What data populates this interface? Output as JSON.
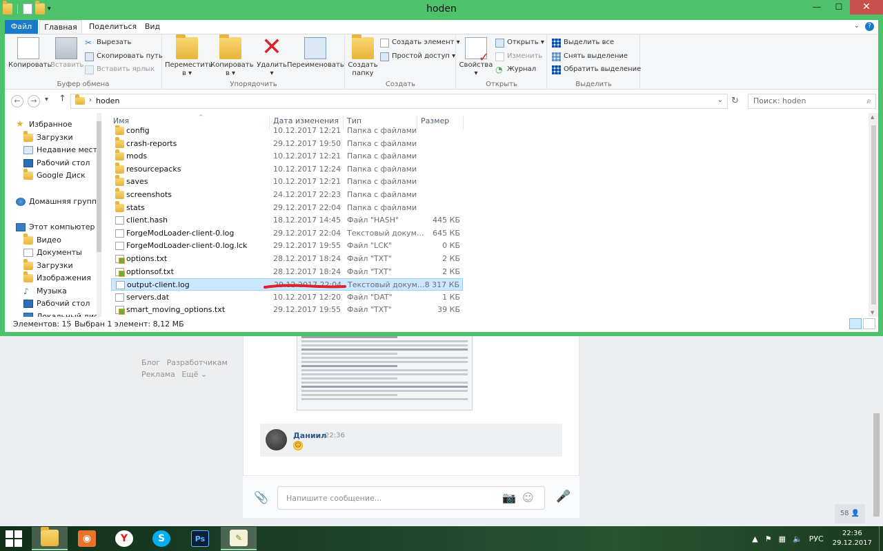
{
  "window": {
    "title": "hoden",
    "controls": {
      "minimize": "—",
      "maximize": "☐",
      "close": "✕"
    }
  },
  "ribbon_tabs": [
    "Файл",
    "Главная",
    "Поделиться",
    "Вид"
  ],
  "ribbon": {
    "clipboard": {
      "label": "Буфер обмена",
      "copy": "Копировать",
      "paste": "Вставить",
      "cut": "Вырезать",
      "copy_path": "Скопировать путь",
      "paste_shortcut": "Вставить ярлык"
    },
    "organize": {
      "label": "Упорядочить",
      "move_to": [
        "Переместить",
        "в ▾"
      ],
      "copy_to": [
        "Копировать",
        "в ▾"
      ],
      "delete": [
        "Удалить",
        "▾"
      ],
      "rename": "Переименовать"
    },
    "new": {
      "label": "Создать",
      "new_folder": [
        "Создать",
        "папку"
      ],
      "new_item": "Создать элемент ▾",
      "easy_access": "Простой доступ ▾"
    },
    "open": {
      "label": "Открыть",
      "properties": [
        "Свойства",
        "▾"
      ],
      "open": "Открыть ▾",
      "edit": "Изменить",
      "history": "Журнал"
    },
    "select": {
      "label": "Выделить",
      "select_all": "Выделить все",
      "select_none": "Снять выделение",
      "invert": "Обратить выделение"
    }
  },
  "address": {
    "path": "hoden",
    "search_placeholder": "Поиск: hoden"
  },
  "nav_pane": {
    "favorites": "Избранное",
    "favorites_items": [
      "Загрузки",
      "Недавние места",
      "Рабочий стол",
      "Google Диск"
    ],
    "homegroup": "Домашняя группа",
    "this_pc": "Этот компьютер",
    "pc_items": [
      "Видео",
      "Документы",
      "Загрузки",
      "Изображения",
      "Музыка",
      "Рабочий стол",
      "Локальный диск"
    ]
  },
  "columns": {
    "name": "Имя",
    "date": "Дата изменения",
    "type": "Тип",
    "size": "Размер"
  },
  "files": [
    {
      "name": "config",
      "date": "10.12.2017 12:21",
      "type": "Папка с файлами",
      "size": "",
      "kind": "folder"
    },
    {
      "name": "crash-reports",
      "date": "29.12.2017 19:50",
      "type": "Папка с файлами",
      "size": "",
      "kind": "folder"
    },
    {
      "name": "mods",
      "date": "10.12.2017 12:21",
      "type": "Папка с файлами",
      "size": "",
      "kind": "folder"
    },
    {
      "name": "resourcepacks",
      "date": "10.12.2017 12:24",
      "type": "Папка с файлами",
      "size": "",
      "kind": "folder"
    },
    {
      "name": "saves",
      "date": "10.12.2017 12:21",
      "type": "Папка с файлами",
      "size": "",
      "kind": "folder"
    },
    {
      "name": "screenshots",
      "date": "24.12.2017 22:23",
      "type": "Папка с файлами",
      "size": "",
      "kind": "folder"
    },
    {
      "name": "stats",
      "date": "29.12.2017 22:04",
      "type": "Папка с файлами",
      "size": "",
      "kind": "folder"
    },
    {
      "name": "client.hash",
      "date": "18.12.2017 14:45",
      "type": "Файл \"HASH\"",
      "size": "445 КБ",
      "kind": "file"
    },
    {
      "name": "ForgeModLoader-client-0.log",
      "date": "29.12.2017 22:04",
      "type": "Текстовый докум...",
      "size": "645 КБ",
      "kind": "file"
    },
    {
      "name": "ForgeModLoader-client-0.log.lck",
      "date": "29.12.2017 19:55",
      "type": "Файл \"LCK\"",
      "size": "0 КБ",
      "kind": "file"
    },
    {
      "name": "options.txt",
      "date": "28.12.2017 18:24",
      "type": "Файл \"TXT\"",
      "size": "2 КБ",
      "kind": "txt"
    },
    {
      "name": "optionsof.txt",
      "date": "28.12.2017 18:24",
      "type": "Файл \"TXT\"",
      "size": "2 КБ",
      "kind": "txt"
    },
    {
      "name": "output-client.log",
      "date": "29.12.2017 22:04",
      "type": "Текстовый докум...",
      "size": "8 317 КБ",
      "kind": "file",
      "selected": true
    },
    {
      "name": "servers.dat",
      "date": "10.12.2017 12:20",
      "type": "Файл \"DAT\"",
      "size": "1 КБ",
      "kind": "file"
    },
    {
      "name": "smart_moving_options.txt",
      "date": "29.12.2017 19:55",
      "type": "Файл \"TXT\"",
      "size": "39 КБ",
      "kind": "txt"
    }
  ],
  "status": {
    "items": "Элементов: 15",
    "selected": "Выбран 1 элемент: 8,12 МБ"
  },
  "vk": {
    "links": [
      "Блог",
      "Разработчикам",
      "Реклама",
      "Ещё ⌄"
    ],
    "author": "Даниил",
    "time": "22:36",
    "emoji": "😅",
    "composer_placeholder": "Напишите сообщение...",
    "online_count": "58 👤"
  },
  "taskbar": {
    "lang": "РУС",
    "time": "22:36",
    "date": "29.12.2017",
    "apps": [
      "file-explorer",
      "media-center",
      "yandex-browser",
      "skype",
      "photoshop",
      "notepad-plus"
    ]
  },
  "colors": {
    "titlebar": "#4ec26a",
    "file_tab": "#1979ca",
    "selection": "#cce8ff",
    "annotation": "#e0202a"
  }
}
